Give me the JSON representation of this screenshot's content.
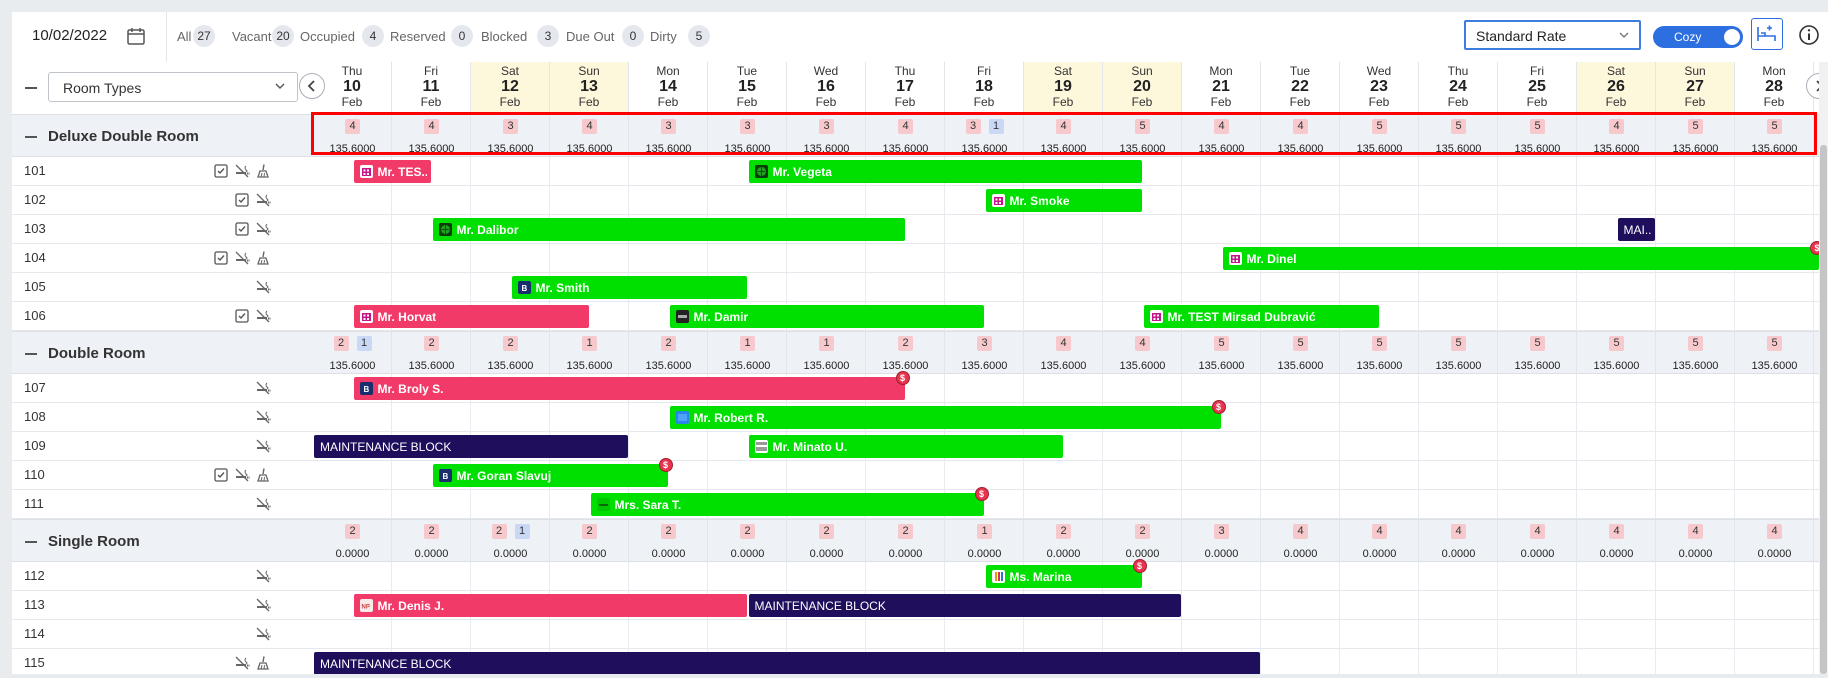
{
  "topbar": {
    "date": "10/02/2022",
    "stats": [
      {
        "label": "All",
        "count": "27"
      },
      {
        "label": "Vacant",
        "count": "20"
      },
      {
        "label": "Occupied",
        "count": "4"
      },
      {
        "label": "Reserved",
        "count": "0"
      },
      {
        "label": "Blocked",
        "count": "3"
      },
      {
        "label": "Due Out",
        "count": "0"
      },
      {
        "label": "Dirty",
        "count": "5"
      }
    ],
    "rate_select": "Standard Rate",
    "view_toggle": "Cozy"
  },
  "filter": {
    "room_types": "Room Types"
  },
  "days": [
    {
      "w": "Thu",
      "d": "10",
      "m": "Feb",
      "we": false
    },
    {
      "w": "Fri",
      "d": "11",
      "m": "Feb",
      "we": false
    },
    {
      "w": "Sat",
      "d": "12",
      "m": "Feb",
      "we": true
    },
    {
      "w": "Sun",
      "d": "13",
      "m": "Feb",
      "we": true
    },
    {
      "w": "Mon",
      "d": "14",
      "m": "Feb",
      "we": false
    },
    {
      "w": "Tue",
      "d": "15",
      "m": "Feb",
      "we": false
    },
    {
      "w": "Wed",
      "d": "16",
      "m": "Feb",
      "we": false
    },
    {
      "w": "Thu",
      "d": "17",
      "m": "Feb",
      "we": false
    },
    {
      "w": "Fri",
      "d": "18",
      "m": "Feb",
      "we": false
    },
    {
      "w": "Sat",
      "d": "19",
      "m": "Feb",
      "we": true
    },
    {
      "w": "Sun",
      "d": "20",
      "m": "Feb",
      "we": true
    },
    {
      "w": "Mon",
      "d": "21",
      "m": "Feb",
      "we": false
    },
    {
      "w": "Tue",
      "d": "22",
      "m": "Feb",
      "we": false
    },
    {
      "w": "Wed",
      "d": "23",
      "m": "Feb",
      "we": false
    },
    {
      "w": "Thu",
      "d": "24",
      "m": "Feb",
      "we": false
    },
    {
      "w": "Fri",
      "d": "25",
      "m": "Feb",
      "we": false
    },
    {
      "w": "Sat",
      "d": "26",
      "m": "Feb",
      "we": true
    },
    {
      "w": "Sun",
      "d": "27",
      "m": "Feb",
      "we": true
    },
    {
      "w": "Mon",
      "d": "28",
      "m": "Feb",
      "we": false
    }
  ],
  "categories": [
    {
      "name": "Deluxe Double Room",
      "avail": [
        [
          "4"
        ],
        [
          "4"
        ],
        [
          "3"
        ],
        [
          "4"
        ],
        [
          "3"
        ],
        [
          "3"
        ],
        [
          "3"
        ],
        [
          "4"
        ],
        [
          "3",
          "1"
        ],
        [
          "4"
        ],
        [
          "5"
        ],
        [
          "4"
        ],
        [
          "4"
        ],
        [
          "5"
        ],
        [
          "5"
        ],
        [
          "5"
        ],
        [
          "4"
        ],
        [
          "5"
        ],
        [
          "5"
        ]
      ],
      "prices": [
        "135.6000",
        "135.6000",
        "135.6000",
        "135.6000",
        "135.6000",
        "135.6000",
        "135.6000",
        "135.6000",
        "135.6000",
        "135.6000",
        "135.6000",
        "135.6000",
        "135.6000",
        "135.6000",
        "135.6000",
        "135.6000",
        "135.6000",
        "135.6000",
        "135.6000"
      ],
      "rooms": [
        {
          "num": "101",
          "icons": [
            "checklist-icon",
            "no-smoking-icon",
            "cleaning-icon"
          ],
          "bars": [
            {
              "start": 0.5,
              "span": 1,
              "color": "pink",
              "label": "Mr. TES...",
              "chan": "building"
            },
            {
              "start": 5.5,
              "span": 5,
              "color": "green",
              "label": "Mr. Vegeta",
              "chan": "globe"
            }
          ]
        },
        {
          "num": "102",
          "icons": [
            "checklist-icon",
            "no-smoking-icon"
          ],
          "bars": [
            {
              "start": 8.5,
              "span": 2,
              "color": "green",
              "label": "Mr. Smoke",
              "chan": "building"
            }
          ]
        },
        {
          "num": "103",
          "icons": [
            "checklist-icon",
            "no-smoking-icon"
          ],
          "bars": [
            {
              "start": 1.5,
              "span": 6,
              "color": "green",
              "label": "Mr. Dalibor",
              "chan": "globe"
            },
            {
              "start": 16.5,
              "span": 0.5,
              "color": "navy",
              "label": "MAI..."
            }
          ]
        },
        {
          "num": "104",
          "icons": [
            "checklist-icon",
            "no-smoking-icon",
            "cleaning-icon"
          ],
          "bars": [
            {
              "start": 11.5,
              "span": 7.6,
              "color": "green",
              "label": "Mr. Dinel",
              "chan": "building",
              "dollar": true
            }
          ]
        },
        {
          "num": "105",
          "icons": [
            "no-smoking-icon"
          ],
          "bars": [
            {
              "start": 2.5,
              "span": 3,
              "color": "green",
              "label": "Mr. Smith",
              "chan": "booking"
            }
          ]
        },
        {
          "num": "106",
          "icons": [
            "checklist-icon",
            "no-smoking-icon"
          ],
          "bars": [
            {
              "start": 0.5,
              "span": 3,
              "color": "pink",
              "label": "Mr. Horvat",
              "chan": "building"
            },
            {
              "start": 4.5,
              "span": 4,
              "color": "green",
              "label": "Mr. Damir",
              "chan": "dark"
            },
            {
              "start": 10.5,
              "span": 3,
              "color": "green",
              "label": "Mr. TEST Mirsad Dubravić",
              "chan": "building"
            }
          ]
        }
      ]
    },
    {
      "name": "Double Room",
      "avail": [
        [
          "2",
          "1"
        ],
        [
          "2"
        ],
        [
          "2"
        ],
        [
          "1"
        ],
        [
          "2"
        ],
        [
          "1"
        ],
        [
          "1"
        ],
        [
          "2"
        ],
        [
          "3"
        ],
        [
          "4"
        ],
        [
          "4"
        ],
        [
          "5"
        ],
        [
          "5"
        ],
        [
          "5"
        ],
        [
          "5"
        ],
        [
          "5"
        ],
        [
          "5"
        ],
        [
          "5"
        ],
        [
          "5"
        ]
      ],
      "prices": [
        "135.6000",
        "135.6000",
        "135.6000",
        "135.6000",
        "135.6000",
        "135.6000",
        "135.6000",
        "135.6000",
        "135.6000",
        "135.6000",
        "135.6000",
        "135.6000",
        "135.6000",
        "135.6000",
        "135.6000",
        "135.6000",
        "135.6000",
        "135.6000",
        "135.6000"
      ],
      "rooms": [
        {
          "num": "107",
          "icons": [
            "no-smoking-icon"
          ],
          "bars": [
            {
              "start": 0.5,
              "span": 7,
              "color": "pink",
              "label": "Mr. Broly S.",
              "chan": "booking",
              "dollar": true
            }
          ]
        },
        {
          "num": "108",
          "icons": [
            "no-smoking-icon"
          ],
          "bars": [
            {
              "start": 4.5,
              "span": 7,
              "color": "green",
              "label": "Mr. Robert R.",
              "chan": "blue",
              "dollar": true
            }
          ]
        },
        {
          "num": "109",
          "icons": [
            "no-smoking-icon"
          ],
          "bars": [
            {
              "start": 0,
              "span": 4,
              "color": "navy",
              "label": "MAINTENANCE BLOCK"
            },
            {
              "start": 5.5,
              "span": 4,
              "color": "green",
              "label": "Mr. Minato U.",
              "chan": "white"
            }
          ]
        },
        {
          "num": "110",
          "icons": [
            "checklist-icon",
            "no-smoking-icon",
            "cleaning-icon"
          ],
          "bars": [
            {
              "start": 1.5,
              "span": 3,
              "color": "green",
              "label": "Mr. Goran Slavuj",
              "chan": "booking",
              "dollar": true
            }
          ]
        },
        {
          "num": "111",
          "icons": [
            "no-smoking-icon"
          ],
          "bars": [
            {
              "start": 3.5,
              "span": 5,
              "color": "green",
              "label": "Mrs. Sara T.",
              "chan": "line",
              "dollar": true
            }
          ]
        }
      ]
    },
    {
      "name": "Single Room",
      "avail": [
        [
          "2"
        ],
        [
          "2"
        ],
        [
          "2",
          "1"
        ],
        [
          "2"
        ],
        [
          "2"
        ],
        [
          "2"
        ],
        [
          "2"
        ],
        [
          "2"
        ],
        [
          "1"
        ],
        [
          "2"
        ],
        [
          "2"
        ],
        [
          "3"
        ],
        [
          "4"
        ],
        [
          "4"
        ],
        [
          "4"
        ],
        [
          "4"
        ],
        [
          "4"
        ],
        [
          "4"
        ],
        [
          "4"
        ]
      ],
      "prices": [
        "0.0000",
        "0.0000",
        "0.0000",
        "0.0000",
        "0.0000",
        "0.0000",
        "0.0000",
        "0.0000",
        "0.0000",
        "0.0000",
        "0.0000",
        "0.0000",
        "0.0000",
        "0.0000",
        "0.0000",
        "0.0000",
        "0.0000",
        "0.0000",
        "0.0000"
      ],
      "rooms": [
        {
          "num": "112",
          "icons": [
            "no-smoking-icon"
          ],
          "bars": [
            {
              "start": 8.5,
              "span": 2,
              "color": "green",
              "label": "Ms. Marina",
              "chan": "book",
              "dollar": true
            }
          ]
        },
        {
          "num": "113",
          "icons": [
            "no-smoking-icon"
          ],
          "bars": [
            {
              "start": 0.5,
              "span": 5,
              "color": "pink",
              "label": "Mr. Denis J.",
              "chan": "light"
            },
            {
              "start": 5.5,
              "span": 5.5,
              "color": "navy",
              "label": "MAINTENANCE BLOCK"
            }
          ]
        },
        {
          "num": "114",
          "icons": [
            "no-smoking-icon"
          ],
          "bars": []
        },
        {
          "num": "115",
          "icons": [
            "no-smoking-icon",
            "cleaning-icon"
          ],
          "bars": [
            {
              "start": 0,
              "span": 12,
              "color": "navy",
              "label": "MAINTENANCE BLOCK"
            }
          ]
        }
      ]
    }
  ]
}
